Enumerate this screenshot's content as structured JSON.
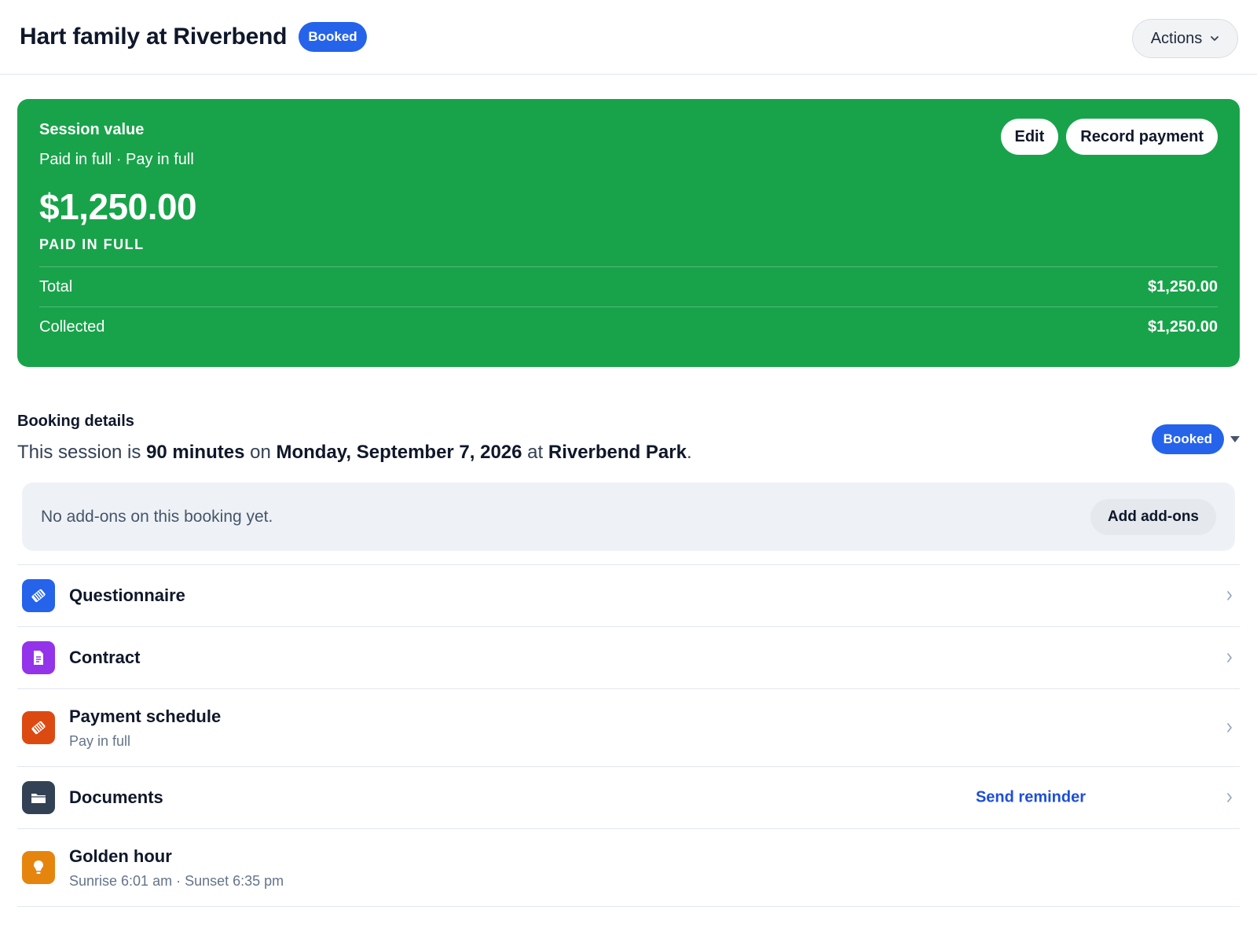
{
  "header": {
    "title": "Hart family at Riverbend",
    "status_badge": "Booked",
    "actions_label": "Actions"
  },
  "session_value": {
    "label": "Session value",
    "subtitle": "Paid in full · Pay in full",
    "amount": "$1,250.00",
    "status": "PAID IN FULL",
    "edit_label": "Edit",
    "record_payment_label": "Record payment",
    "rows": [
      {
        "label": "Total",
        "value": "$1,250.00"
      },
      {
        "label": "Collected",
        "value": "$1,250.00"
      }
    ]
  },
  "booking": {
    "heading": "Booking details",
    "sentence": {
      "prefix": "This session is ",
      "duration": "90 minutes",
      "on": " on ",
      "date": "Monday, September 7, 2026",
      "at": " at ",
      "location": "Riverbend Park",
      "suffix": "."
    },
    "status": "Booked"
  },
  "addons": {
    "empty_text": "No add-ons on this booking yet.",
    "button_label": "Add add-ons"
  },
  "items": [
    {
      "title": "Questionnaire",
      "subtitle": "",
      "icon": "clipboard-icon",
      "color": "#2563eb"
    },
    {
      "title": "Contract",
      "subtitle": "",
      "icon": "document-icon",
      "color": "#9333ea"
    },
    {
      "title": "Payment schedule",
      "subtitle": "Pay in full",
      "icon": "tag-icon",
      "color": "#dc4a12"
    },
    {
      "title": "Documents",
      "subtitle": "",
      "icon": "folder-icon",
      "color": "#334155",
      "action": "Send reminder"
    },
    {
      "title": "Golden hour",
      "subtitle": "Sunrise 6:01 am · Sunset 6:35 pm",
      "icon": "lightbulb-icon",
      "color": "#e6850e"
    }
  ],
  "colors": {
    "accent_blue": "#2563eb",
    "card_green": "#18a34a"
  }
}
